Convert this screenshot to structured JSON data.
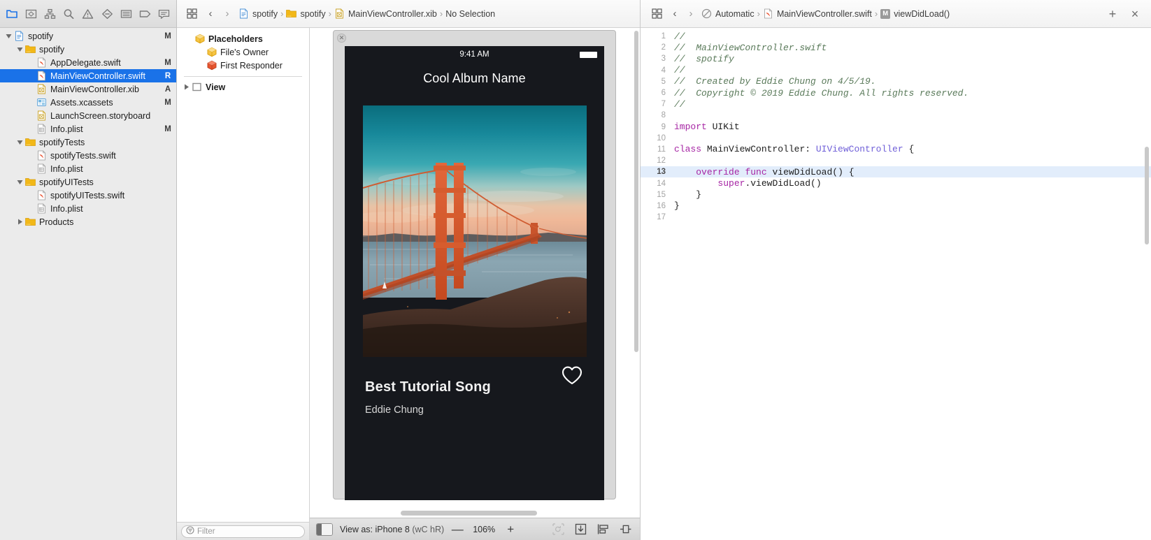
{
  "navigator": {
    "toolbar_icons": [
      {
        "name": "project-navigator-icon",
        "active": true
      },
      {
        "name": "source-control-navigator-icon",
        "active": false
      },
      {
        "name": "symbol-navigator-icon",
        "active": false
      },
      {
        "name": "find-navigator-icon",
        "active": false
      },
      {
        "name": "issue-navigator-icon",
        "active": false
      },
      {
        "name": "test-navigator-icon",
        "active": false
      },
      {
        "name": "debug-navigator-icon",
        "active": false
      },
      {
        "name": "breakpoint-navigator-icon",
        "active": false
      },
      {
        "name": "report-navigator-icon",
        "active": false
      }
    ],
    "tree": [
      {
        "label": "spotify",
        "icon": "xcode-project-icon",
        "indent": 0,
        "disclosure": "open",
        "flag": "M",
        "selected": false
      },
      {
        "label": "spotify",
        "icon": "folder-icon",
        "indent": 1,
        "disclosure": "open",
        "flag": "",
        "selected": false
      },
      {
        "label": "AppDelegate.swift",
        "icon": "swift-file-icon",
        "indent": 2,
        "disclosure": "none",
        "flag": "M",
        "selected": false
      },
      {
        "label": "MainViewController.swift",
        "icon": "swift-file-icon",
        "indent": 2,
        "disclosure": "none",
        "flag": "R",
        "selected": true
      },
      {
        "label": "MainViewController.xib",
        "icon": "xib-file-icon",
        "indent": 2,
        "disclosure": "none",
        "flag": "A",
        "selected": false
      },
      {
        "label": "Assets.xcassets",
        "icon": "assets-catalog-icon",
        "indent": 2,
        "disclosure": "none",
        "flag": "M",
        "selected": false
      },
      {
        "label": "LaunchScreen.storyboard",
        "icon": "storyboard-file-icon",
        "indent": 2,
        "disclosure": "none",
        "flag": "",
        "selected": false
      },
      {
        "label": "Info.plist",
        "icon": "plist-file-icon",
        "indent": 2,
        "disclosure": "none",
        "flag": "M",
        "selected": false
      },
      {
        "label": "spotifyTests",
        "icon": "folder-icon",
        "indent": 1,
        "disclosure": "open",
        "flag": "",
        "selected": false
      },
      {
        "label": "spotifyTests.swift",
        "icon": "swift-file-icon",
        "indent": 2,
        "disclosure": "none",
        "flag": "",
        "selected": false
      },
      {
        "label": "Info.plist",
        "icon": "plist-file-icon",
        "indent": 2,
        "disclosure": "none",
        "flag": "",
        "selected": false
      },
      {
        "label": "spotifyUITests",
        "icon": "folder-icon",
        "indent": 1,
        "disclosure": "open",
        "flag": "",
        "selected": false
      },
      {
        "label": "spotifyUITests.swift",
        "icon": "swift-file-icon",
        "indent": 2,
        "disclosure": "none",
        "flag": "",
        "selected": false
      },
      {
        "label": "Info.plist",
        "icon": "plist-file-icon",
        "indent": 2,
        "disclosure": "none",
        "flag": "",
        "selected": false
      },
      {
        "label": "Products",
        "icon": "folder-icon",
        "indent": 1,
        "disclosure": "closed",
        "flag": "",
        "selected": false
      }
    ]
  },
  "ib": {
    "breadcrumb": [
      {
        "label": "spotify",
        "icon": "xcode-project-icon"
      },
      {
        "label": "spotify",
        "icon": "folder-icon"
      },
      {
        "label": "MainViewController.xib",
        "icon": "xib-file-icon"
      },
      {
        "label": "No Selection",
        "icon": "none"
      }
    ],
    "outline": {
      "rows": [
        {
          "label": "Placeholders",
          "icon": "placeholder-cube-icon",
          "indent": 0,
          "disclosure": "none",
          "bold": true
        },
        {
          "label": "File's Owner",
          "icon": "files-owner-cube-icon",
          "indent": 1,
          "disclosure": "none",
          "bold": false
        },
        {
          "label": "First Responder",
          "icon": "first-responder-cube-icon",
          "indent": 1,
          "disclosure": "none",
          "bold": false
        }
      ],
      "view_row": {
        "label": "View",
        "icon": "view-square-icon",
        "disclosure": "closed",
        "bold": true
      }
    },
    "filter": {
      "placeholder": "Filter"
    },
    "bottom": {
      "view_as_prefix": "View as: ",
      "device": "iPhone 8",
      "size_class": "(wC hR)",
      "zoom_out": "—",
      "zoom_value": "106%",
      "zoom_in": "+",
      "icons": [
        {
          "name": "update-frames-icon",
          "disabled": true
        },
        {
          "name": "embed-in-icon",
          "disabled": false
        },
        {
          "name": "align-icon",
          "disabled": false
        },
        {
          "name": "resolve-auto-layout-issues-icon",
          "disabled": false
        }
      ]
    }
  },
  "preview": {
    "status_time": "9:41 AM",
    "album_title": "Cool Album Name",
    "song_title": "Best Tutorial Song",
    "artist": "Eddie Chung",
    "favorite_icon": "heart-outline-icon",
    "artwork_alt": "Golden Gate Bridge at sunset",
    "colors": {
      "screen_bg": "#16181d",
      "sky_top": "#0d7f8e",
      "sky_mid": "#29a3b0",
      "horizon": "#f3c3a3",
      "water": "#8fa8b4",
      "bridge": "#d85a27",
      "headland": "#4a3127"
    }
  },
  "editor": {
    "breadcrumb": [
      {
        "label": "Automatic",
        "icon": "automatic-icon"
      },
      {
        "label": "MainViewController.swift",
        "icon": "swift-file-icon"
      },
      {
        "label": "viewDidLoad()",
        "icon": "method-m-icon"
      }
    ],
    "add_button": "+",
    "close_button": "×",
    "highlighted_line": 13,
    "lines": [
      {
        "n": 1,
        "indent": 0,
        "tokens": [
          {
            "t": "//",
            "c": "cmt"
          }
        ]
      },
      {
        "n": 2,
        "indent": 0,
        "tokens": [
          {
            "t": "//  MainViewController.swift",
            "c": "cmt"
          }
        ]
      },
      {
        "n": 3,
        "indent": 0,
        "tokens": [
          {
            "t": "//  spotify",
            "c": "cmt"
          }
        ]
      },
      {
        "n": 4,
        "indent": 0,
        "tokens": [
          {
            "t": "//",
            "c": "cmt"
          }
        ]
      },
      {
        "n": 5,
        "indent": 0,
        "tokens": [
          {
            "t": "//  Created by Eddie Chung on 4/5/19.",
            "c": "cmt"
          }
        ]
      },
      {
        "n": 6,
        "indent": 0,
        "tokens": [
          {
            "t": "//  Copyright © 2019 Eddie Chung. All rights reserved.",
            "c": "cmt"
          }
        ]
      },
      {
        "n": 7,
        "indent": 0,
        "tokens": [
          {
            "t": "//",
            "c": "cmt"
          }
        ]
      },
      {
        "n": 8,
        "indent": 0,
        "tokens": []
      },
      {
        "n": 9,
        "indent": 0,
        "tokens": [
          {
            "t": "import",
            "c": "kw"
          },
          {
            "t": " UIKit",
            "c": "pln"
          }
        ]
      },
      {
        "n": 10,
        "indent": 0,
        "tokens": []
      },
      {
        "n": 11,
        "indent": 0,
        "tokens": [
          {
            "t": "class",
            "c": "kw"
          },
          {
            "t": " MainViewController: ",
            "c": "pln"
          },
          {
            "t": "UIViewController",
            "c": "typ"
          },
          {
            "t": " {",
            "c": "pln"
          }
        ]
      },
      {
        "n": 12,
        "indent": 0,
        "tokens": []
      },
      {
        "n": 13,
        "indent": 1,
        "tokens": [
          {
            "t": "override",
            "c": "kw"
          },
          {
            "t": " ",
            "c": "pln"
          },
          {
            "t": "func",
            "c": "kw"
          },
          {
            "t": " viewDidLoad() {",
            "c": "pln"
          }
        ]
      },
      {
        "n": 14,
        "indent": 2,
        "tokens": [
          {
            "t": "super",
            "c": "kw"
          },
          {
            "t": ".viewDidLoad()",
            "c": "pln"
          }
        ]
      },
      {
        "n": 15,
        "indent": 1,
        "tokens": [
          {
            "t": "}",
            "c": "pln"
          }
        ]
      },
      {
        "n": 16,
        "indent": 0,
        "tokens": [
          {
            "t": "}",
            "c": "pln"
          }
        ]
      },
      {
        "n": 17,
        "indent": 0,
        "tokens": []
      }
    ]
  }
}
